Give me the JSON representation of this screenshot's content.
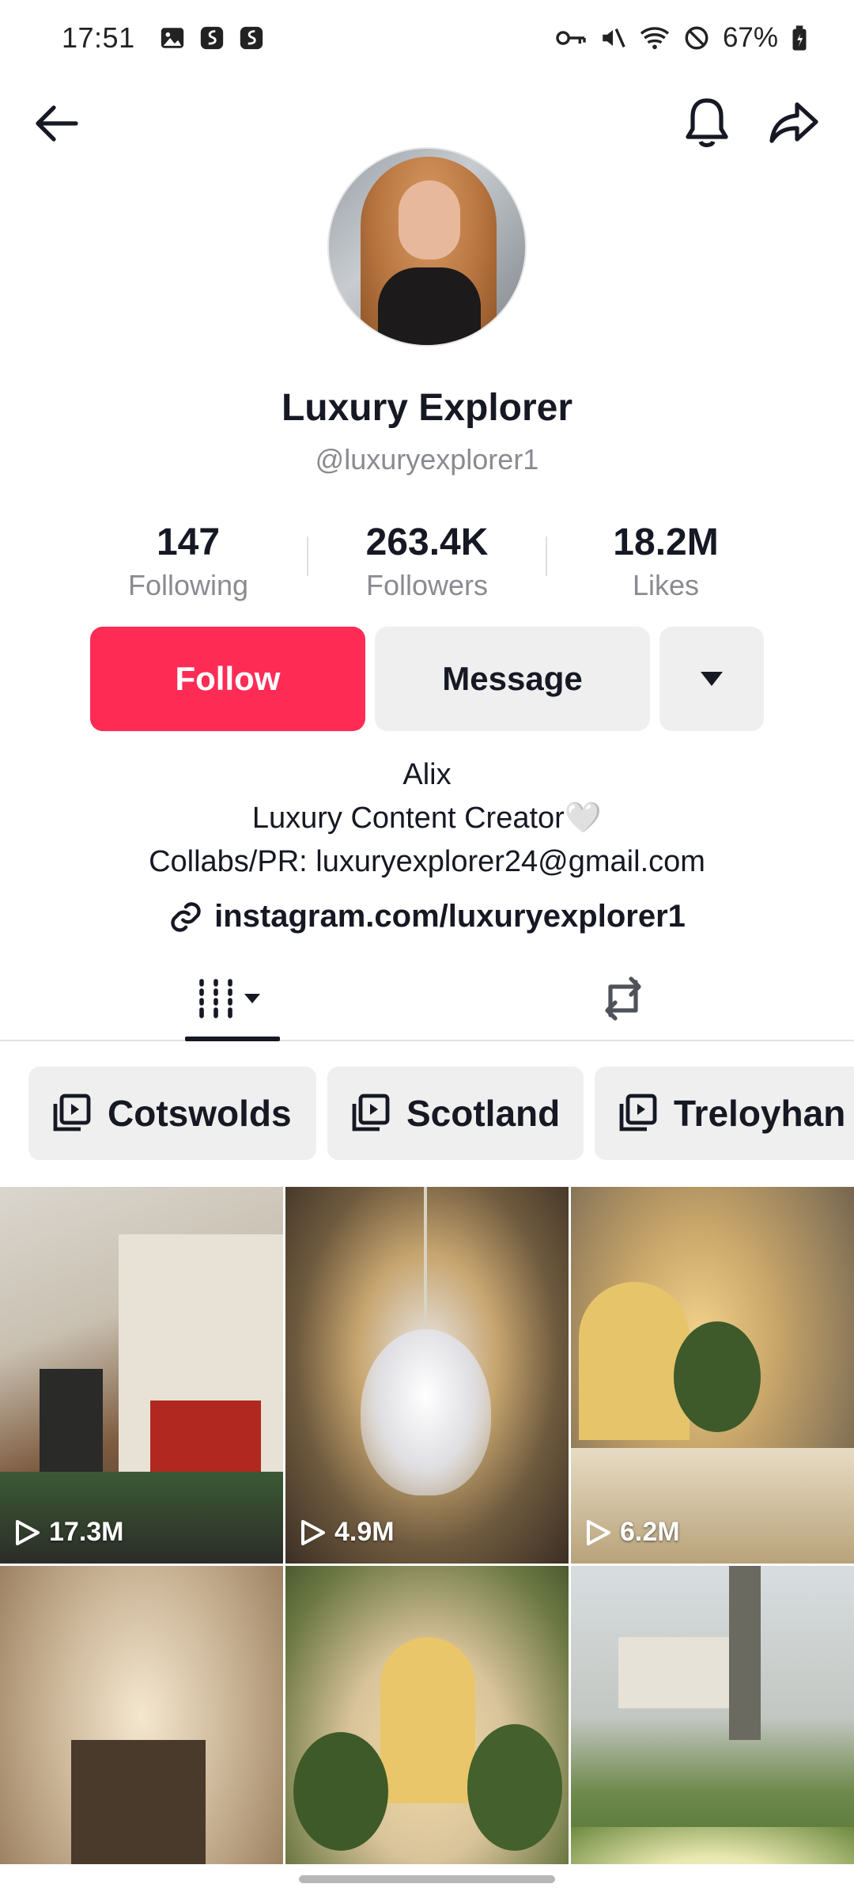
{
  "status_bar": {
    "time": "17:51",
    "battery": "67%",
    "icons_left": [
      "image-icon",
      "app-s-icon",
      "app-s-icon"
    ],
    "icons_right": [
      "vpn-key-icon",
      "mute-icon",
      "wifi-icon",
      "dnd-icon",
      "battery-icon"
    ]
  },
  "nav": {
    "back_icon": "arrow-left-icon",
    "bell_icon": "bell-icon",
    "share_icon": "share-arrow-icon"
  },
  "profile": {
    "display_name": "Luxury Explorer",
    "handle": "@luxuryexplorer1",
    "avatar_icon": "avatar-photo"
  },
  "stats": {
    "following": {
      "value": "147",
      "label": "Following"
    },
    "followers": {
      "value": "263.4K",
      "label": "Followers"
    },
    "likes": {
      "value": "18.2M",
      "label": "Likes"
    }
  },
  "actions": {
    "follow_label": "Follow",
    "message_label": "Message",
    "more_icon": "caret-down-icon"
  },
  "bio": {
    "line1": "Alix",
    "line2": "Luxury Content Creator🤍",
    "line3": "Collabs/PR: luxuryexplorer24@gmail.com",
    "link": "instagram.com/luxuryexplorer1",
    "link_icon": "link-icon"
  },
  "tabs": [
    {
      "name": "videos",
      "icon": "grid-bars-icon",
      "active": true
    },
    {
      "name": "reposts",
      "icon": "repost-icon",
      "active": false
    }
  ],
  "playlists": [
    {
      "label": "Cotswolds",
      "icon": "playlist-icon"
    },
    {
      "label": "Scotland",
      "icon": "playlist-icon"
    },
    {
      "label": "Treloyhan",
      "icon": "playlist-icon"
    }
  ],
  "videos": [
    {
      "views": "17.3M"
    },
    {
      "views": "4.9M"
    },
    {
      "views": "6.2M"
    },
    {
      "views": ""
    },
    {
      "views": ""
    },
    {
      "views": ""
    }
  ],
  "colors": {
    "accent": "#fe2c55",
    "text": "#161823",
    "muted": "#8a8b91",
    "button_bg": "#efefef"
  }
}
